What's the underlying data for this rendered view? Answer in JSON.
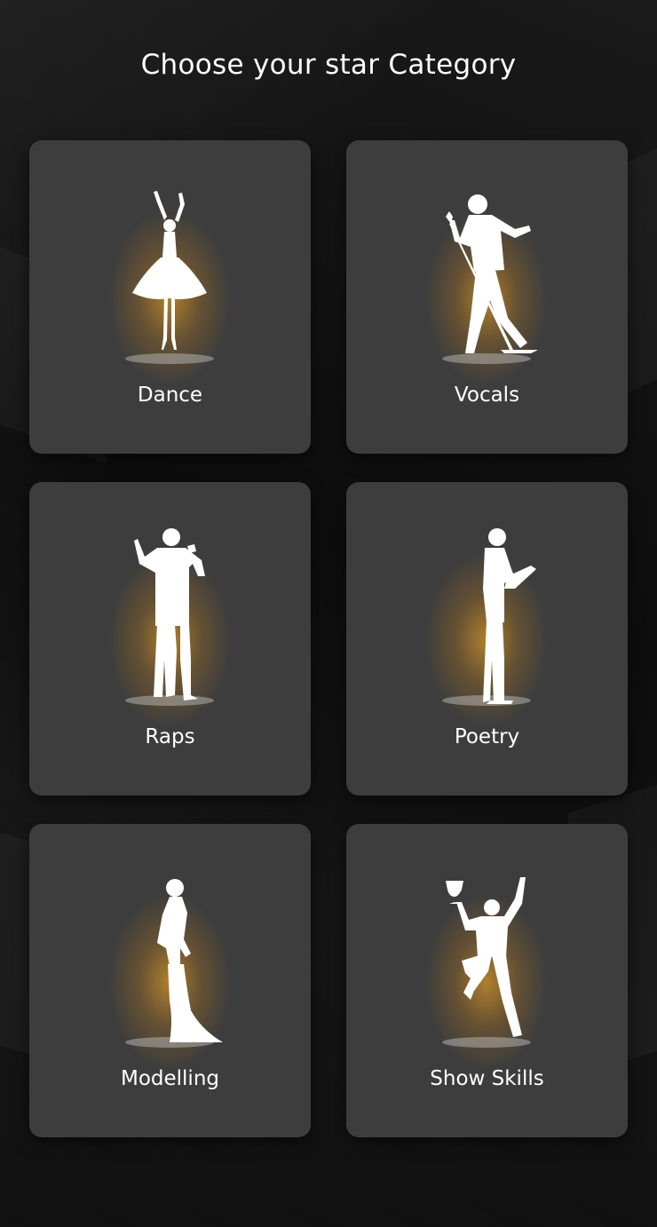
{
  "header": {
    "title": "Choose your star Category"
  },
  "categories": [
    {
      "label": "Dance",
      "icon": "ballerina-silhouette-icon"
    },
    {
      "label": "Vocals",
      "icon": "singer-with-mic-stand-silhouette-icon"
    },
    {
      "label": "Raps",
      "icon": "rapper-with-mic-silhouette-icon"
    },
    {
      "label": "Poetry",
      "icon": "man-reading-book-silhouette-icon"
    },
    {
      "label": "Modelling",
      "icon": "model-in-gown-silhouette-icon"
    },
    {
      "label": "Show Skills",
      "icon": "man-holding-trophy-silhouette-icon"
    }
  ],
  "colors": {
    "card": "#3d3d3d",
    "glow": "#d69628",
    "text": "#ffffff",
    "background": "#0b0b0b"
  }
}
